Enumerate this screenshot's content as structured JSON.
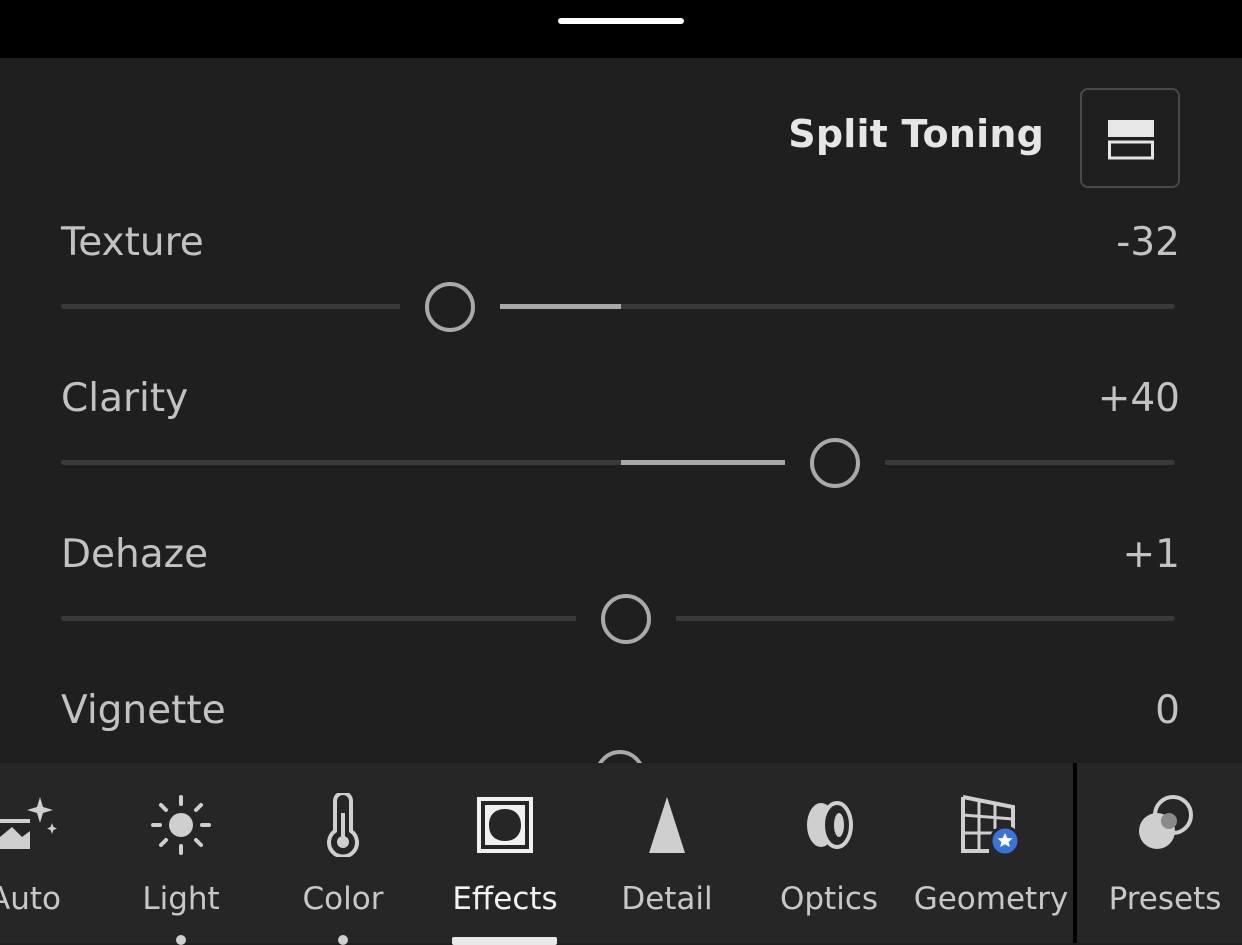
{
  "header": {
    "split_toning_label": "Split Toning",
    "split_toning_icon": "split-view-icon"
  },
  "sliders": [
    {
      "label": "Texture",
      "value_text": "-32",
      "value": -32,
      "range": [
        -100,
        100
      ]
    },
    {
      "label": "Clarity",
      "value_text": "+40",
      "value": 40,
      "range": [
        -100,
        100
      ]
    },
    {
      "label": "Dehaze",
      "value_text": "+1",
      "value": 1,
      "range": [
        -100,
        100
      ]
    },
    {
      "label": "Vignette",
      "value_text": "0",
      "value": 0,
      "range": [
        -100,
        100
      ]
    }
  ],
  "toolbar": {
    "tools": [
      {
        "label": "Auto",
        "icon": "auto-sparkle-icon",
        "active": false
      },
      {
        "label": "Light",
        "icon": "sun-icon",
        "active": false
      },
      {
        "label": "Color",
        "icon": "thermometer-icon",
        "active": false
      },
      {
        "label": "Effects",
        "icon": "vignette-frame-icon",
        "active": true
      },
      {
        "label": "Detail",
        "icon": "cone-icon",
        "active": false
      },
      {
        "label": "Optics",
        "icon": "lens-icon",
        "active": false
      },
      {
        "label": "Geometry",
        "icon": "perspective-grid-icon",
        "active": false
      },
      {
        "label": "Presets",
        "icon": "presets-circles-icon",
        "active": false
      }
    ]
  },
  "colors": {
    "background": "#1f1f1f",
    "toolbar": "#262626",
    "accent_badge": "#3b73d9"
  }
}
